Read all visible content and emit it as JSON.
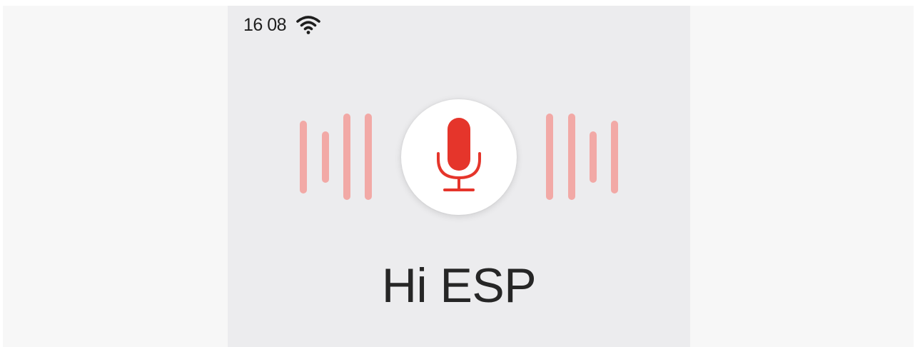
{
  "status_bar": {
    "time": "16 08",
    "wifi_icon": "wifi-icon"
  },
  "voice_assistant": {
    "mic_icon": "microphone-icon",
    "wake_word": "Hi ESP"
  },
  "colors": {
    "accent": "#e5352b",
    "wave": "#f2a9a6",
    "screen_background": "#ececee"
  }
}
